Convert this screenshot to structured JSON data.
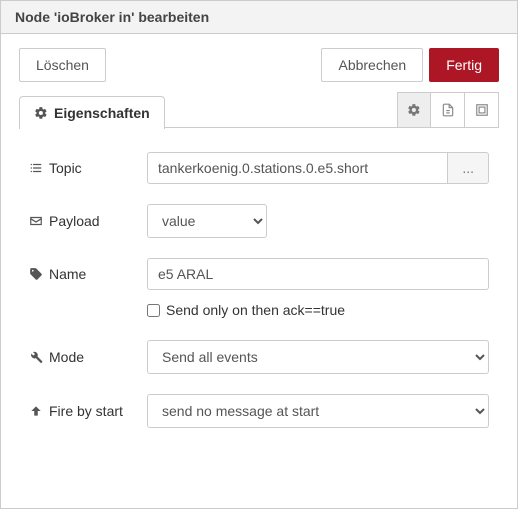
{
  "header": {
    "title": "Node 'ioBroker in' bearbeiten"
  },
  "toolbar": {
    "delete_label": "Löschen",
    "cancel_label": "Abbrechen",
    "done_label": "Fertig"
  },
  "tabs": {
    "properties_label": "Eigenschaften"
  },
  "form": {
    "topic": {
      "label": "Topic",
      "value": "tankerkoenig.0.stations.0.e5.short",
      "browse": "..."
    },
    "payload": {
      "label": "Payload",
      "options": [
        "value"
      ],
      "selected": "value"
    },
    "name": {
      "label": "Name",
      "value": "e5 ARAL"
    },
    "ack": {
      "label": "Send only on then ack==true",
      "checked": false
    },
    "mode": {
      "label": "Mode",
      "options": [
        "Send all events"
      ],
      "selected": "Send all events"
    },
    "fire_by_start": {
      "label": "Fire by start",
      "options": [
        "send no message at start"
      ],
      "selected": "send no message at start"
    }
  }
}
